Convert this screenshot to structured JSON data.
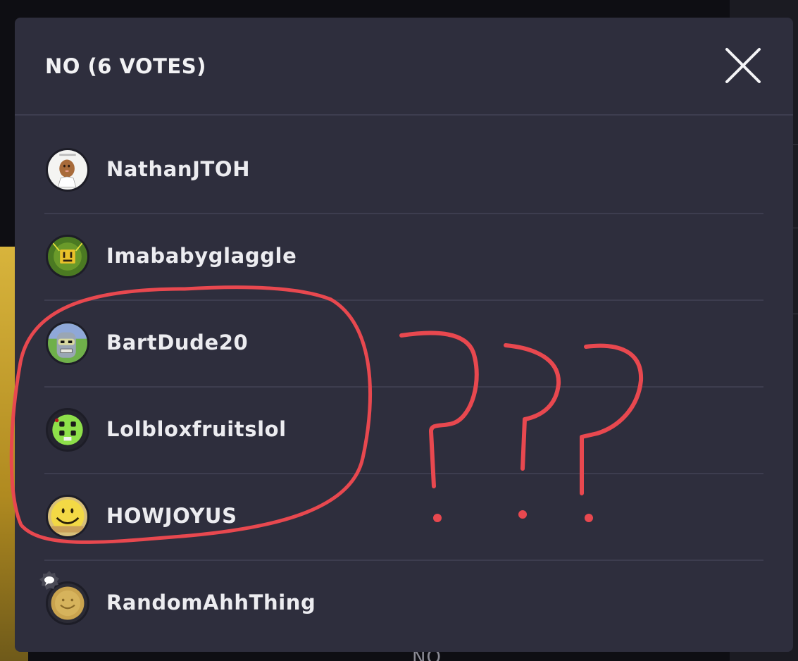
{
  "modal": {
    "title": "NO (6 VOTES)",
    "close_icon": "close-icon"
  },
  "voters": [
    {
      "name": "NathanJTOH",
      "avatar": "potato-face-avatar"
    },
    {
      "name": "Imababyglaggle",
      "avatar": "green-yellow-face-avatar"
    },
    {
      "name": "BartDude20",
      "avatar": "robot-face-avatar"
    },
    {
      "name": "Lolbloxfruitslol",
      "avatar": "green-zombie-face-avatar"
    },
    {
      "name": "HOWJOYUS",
      "avatar": "smiley-face-avatar"
    },
    {
      "name": "RandomAhhThing",
      "avatar": "gold-smiley-coin-avatar",
      "badge": "chat-bubble-icon"
    }
  ],
  "annotation": {
    "circle_color": "#e8484f",
    "marks": "???"
  },
  "background": {
    "bottom_text": "NO"
  }
}
